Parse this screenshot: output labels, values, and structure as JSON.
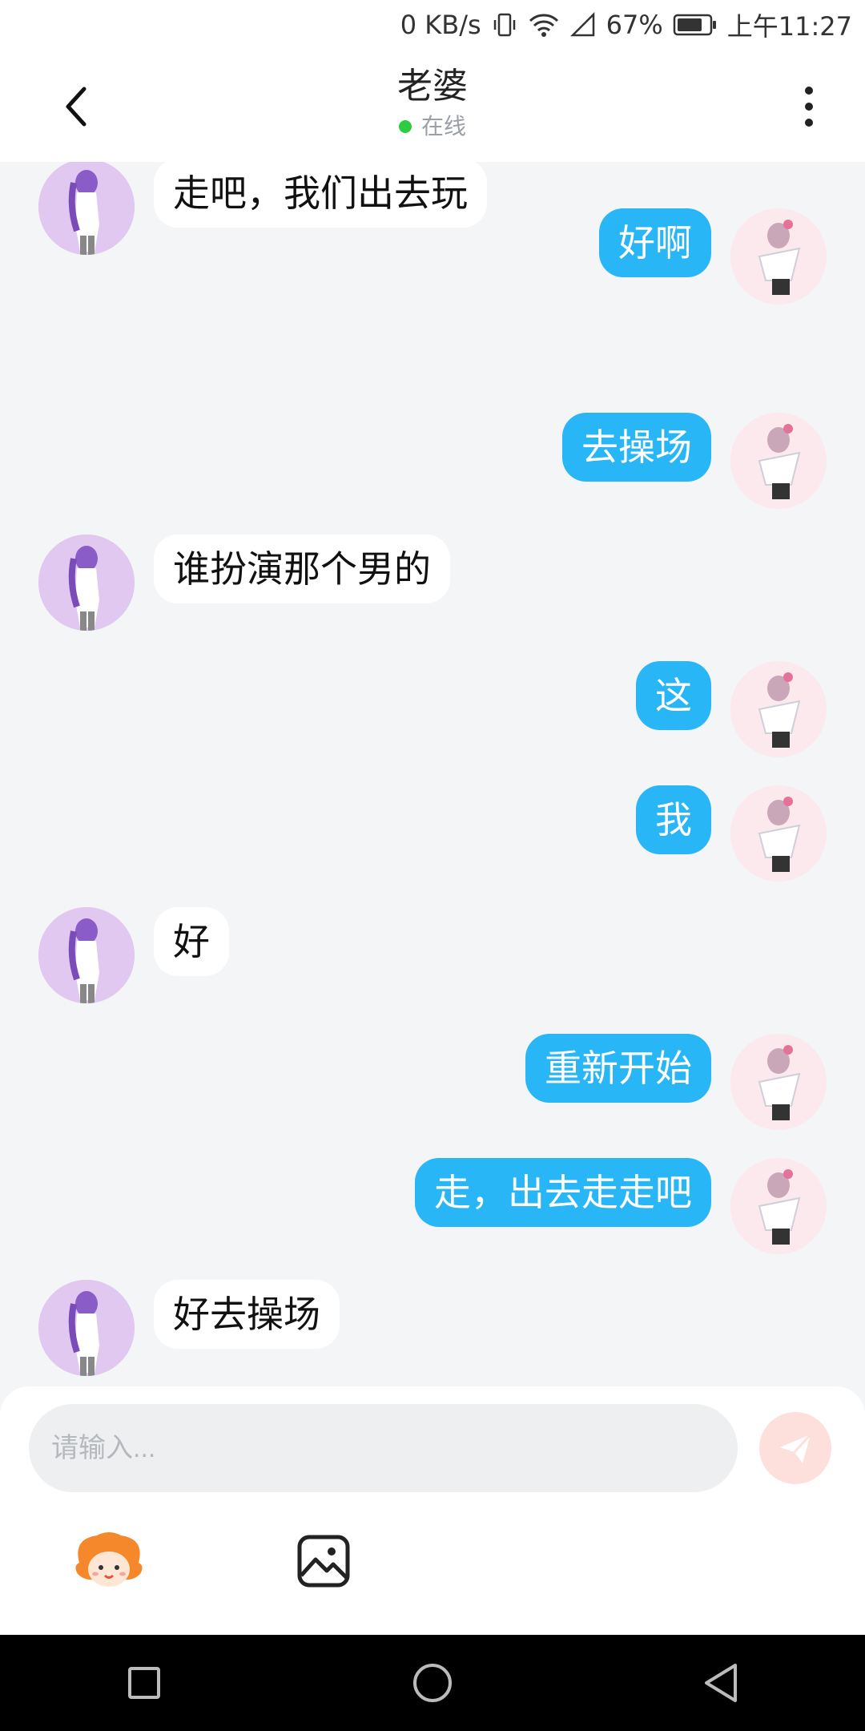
{
  "status_bar": {
    "speed": "0 KB/s",
    "battery": "67%",
    "time": "上午11:27",
    "icons": [
      "vibrate-icon",
      "wifi-icon",
      "signal-icon",
      "battery-icon"
    ]
  },
  "header": {
    "title": "老婆",
    "status": "在线",
    "status_color": "#2ecc40",
    "back_icon": "chevron-left-icon",
    "more_icon": "more-vertical-icon"
  },
  "messages": [
    {
      "side": "left",
      "text": "走吧，我们出去玩"
    },
    {
      "side": "right",
      "text": "好啊"
    },
    {
      "side": "right",
      "text": "去操场"
    },
    {
      "side": "left",
      "text": "谁扮演那个男的"
    },
    {
      "side": "right",
      "text": "这"
    },
    {
      "side": "right",
      "text": "我"
    },
    {
      "side": "left",
      "text": "好"
    },
    {
      "side": "right",
      "text": "重新开始"
    },
    {
      "side": "right",
      "text": "走，出去走走吧"
    },
    {
      "side": "left",
      "text": "好去操场"
    }
  ],
  "input": {
    "placeholder": "请输入...",
    "value": "",
    "send_icon": "send-icon"
  },
  "toolbar": {
    "emoji_icon": "emoji-mascot-icon",
    "image_icon": "image-icon"
  },
  "colors": {
    "sent_bubble": "#29b6f6",
    "received_bubble": "#ffffff",
    "background": "#f4f5f7"
  },
  "nav": [
    "square-recent-icon",
    "circle-home-icon",
    "triangle-back-icon"
  ]
}
